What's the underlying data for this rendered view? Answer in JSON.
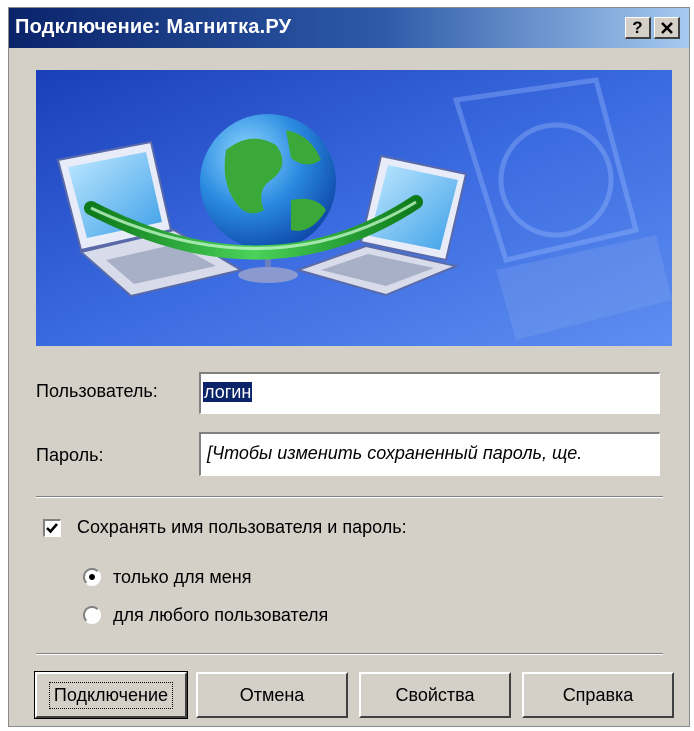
{
  "window": {
    "title": "Подключение: Магнитка.РУ",
    "help_button": "?",
    "close_button": "×"
  },
  "banner": {
    "icon": "network-connection-illustration"
  },
  "form": {
    "user_label": "Пользователь:",
    "user_value": "логин",
    "password_label": "Пароль:",
    "password_value": "[Чтобы изменить сохраненный пароль, ще."
  },
  "save": {
    "checkbox_label": "Сохранять имя пользователя и пароль:",
    "checked": true,
    "option_me": "только для меня",
    "option_any": "для любого пользователя",
    "selected": "only_me"
  },
  "buttons": {
    "connect": "Подключение",
    "cancel": "Отмена",
    "properties": "Свойства",
    "help": "Справка"
  },
  "colors": {
    "title_start": "#0a246a",
    "title_end": "#a6caf0",
    "dialog_bg": "#d4d0c8"
  }
}
